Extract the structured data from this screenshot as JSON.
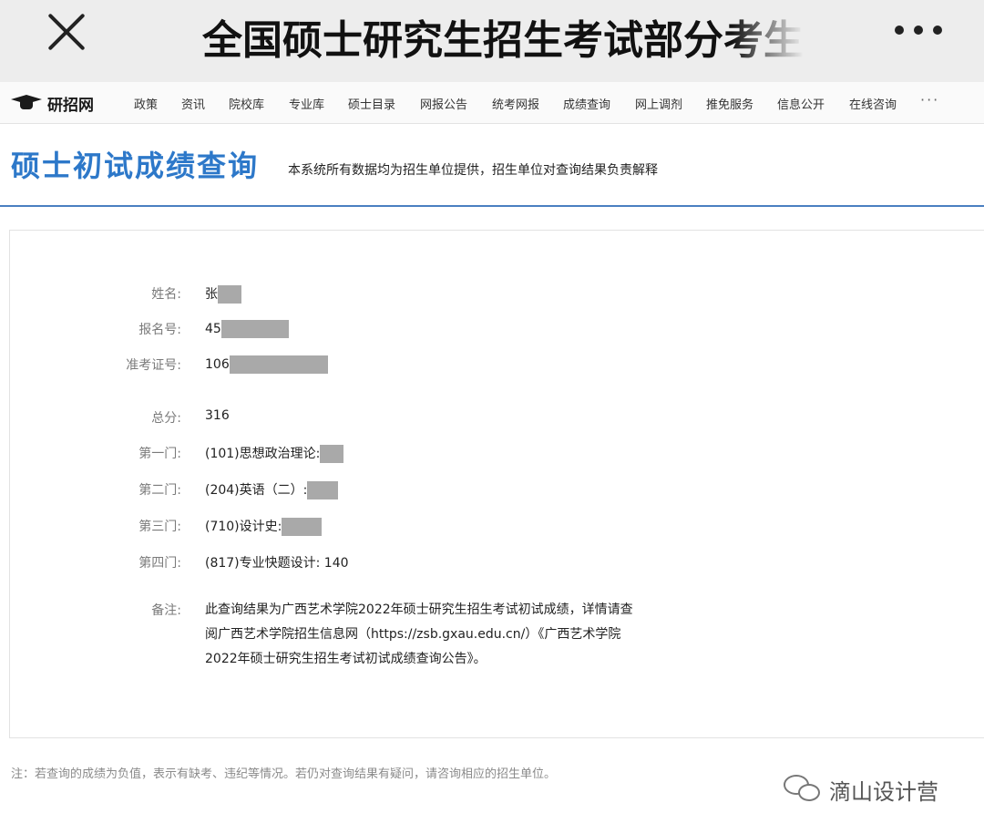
{
  "window": {
    "title": "全国硕士研究生招生考试部分考生"
  },
  "nav": {
    "logo_text": "研招网",
    "items": [
      "政策",
      "资讯",
      "院校库",
      "专业库",
      "硕士目录",
      "网报公告",
      "统考网报",
      "成绩查询",
      "网上调剂",
      "推免服务",
      "信息公开",
      "在线咨询"
    ],
    "more": "···"
  },
  "heading": {
    "title": "硕士初试成绩查询",
    "description": "本系统所有数据均为招生单位提供，招生单位对查询结果负责解释"
  },
  "result": {
    "name": {
      "label": "姓名:",
      "value": "张"
    },
    "registration_no": {
      "label": "报名号:",
      "value": "45"
    },
    "admission_ticket_no": {
      "label": "准考证号:",
      "value": "106"
    },
    "total": {
      "label": "总分:",
      "value": "316"
    },
    "subject1": {
      "label": "第一门:",
      "value": "(101)思想政治理论:"
    },
    "subject2": {
      "label": "第二门:",
      "value": "(204)英语（二）:"
    },
    "subject3": {
      "label": "第三门:",
      "value": "(710)设计史:"
    },
    "subject4": {
      "label": "第四门:",
      "value": "(817)专业快题设计: 140"
    },
    "remark": {
      "label": "备注:",
      "text": "此查询结果为广西艺术学院2022年硕士研究生招生考试初试成绩，详情请查阅广西艺术学院招生信息网（https://zsb.gxau.edu.cn/）《广西艺术学院2022年硕士研究生招生考试初试成绩查询公告》。"
    }
  },
  "footnote": "注：若查询的成绩为负值，表示有缺考、违纪等情况。若仍对查询结果有疑问，请咨询相应的招生单位。",
  "watermark": {
    "icon": "wechat-icon",
    "text": "滴山设计营"
  }
}
